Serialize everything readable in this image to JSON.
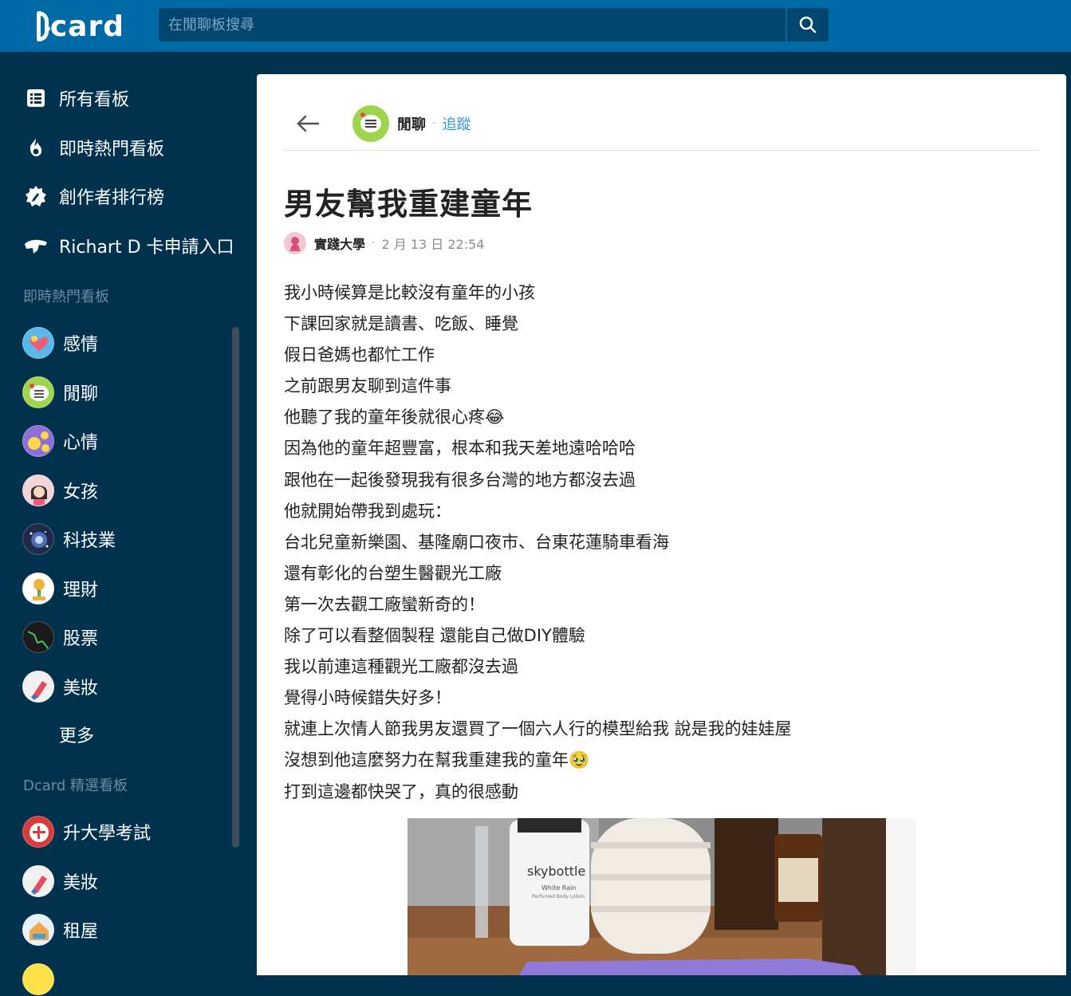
{
  "header": {
    "logo_text": "card",
    "search_placeholder": "在閒聊板搜尋"
  },
  "sidebar": {
    "nav": [
      {
        "label": "所有看板",
        "icon": "list-icon"
      },
      {
        "label": "即時熱門看板",
        "icon": "fire-icon"
      },
      {
        "label": "創作者排行榜",
        "icon": "pen-icon"
      },
      {
        "label": "Richart D 卡申請入口",
        "icon": "card-icon"
      }
    ],
    "section_hot": "即時熱門看板",
    "hot_boards": [
      {
        "label": "感情",
        "color": "#5ab7ea"
      },
      {
        "label": "閒聊",
        "color": "#9fd54c"
      },
      {
        "label": "心情",
        "color": "#8e6fd6"
      },
      {
        "label": "女孩",
        "color": "#f3d3d8"
      },
      {
        "label": "科技業",
        "color": "#1f2a4a"
      },
      {
        "label": "理財",
        "color": "#ffffff"
      },
      {
        "label": "股票",
        "color": "#1a1a1a"
      },
      {
        "label": "美妝",
        "color": "#f0f0f0"
      }
    ],
    "more_label": "更多",
    "section_featured": "Dcard 精選看板",
    "featured_boards": [
      {
        "label": "升大學考試",
        "color": "#d93b3b"
      },
      {
        "label": "美妝",
        "color": "#f0f0f0"
      },
      {
        "label": "租屋",
        "color": "#e6f1fb"
      }
    ]
  },
  "post": {
    "forum_name": "閒聊",
    "follow_label": "追蹤",
    "title": "男友幫我重建童年",
    "school": "實踐大學",
    "time": "2 月 13 日 22:54",
    "lines": [
      "我小時候算是比較沒有童年的小孩",
      "下課回家就是讀書、吃飯、睡覺",
      "假日爸媽也都忙工作",
      "之前跟男友聊到這件事",
      "他聽了我的童年後就很心疼😂",
      "因為他的童年超豐富，根本和我天差地遠哈哈哈",
      "跟他在一起後發現我有很多台灣的地方都沒去過",
      "他就開始帶我到處玩：",
      "台北兒童新樂園、基隆廟口夜市、台東花蓮騎車看海",
      "還有彰化的台塑生醫觀光工廠",
      "第一次去觀工廠蠻新奇的！",
      "除了可以看整個製程 還能自己做DIY體驗",
      "我以前連這種觀光工廠都沒去過",
      "覺得小時候錯失好多！",
      "就連上次情人節我男友還買了一個六人行的模型給我 說是我的娃娃屋",
      "沒想到他這麼努力在幫我重建我的童年🥹",
      "打到這邊都快哭了，真的很感動"
    ],
    "photo_labels": {
      "bottle_brand": "skybottle",
      "bottle_line1": "White Rain",
      "bottle_line2": "Perfumed Body Lotion"
    }
  }
}
